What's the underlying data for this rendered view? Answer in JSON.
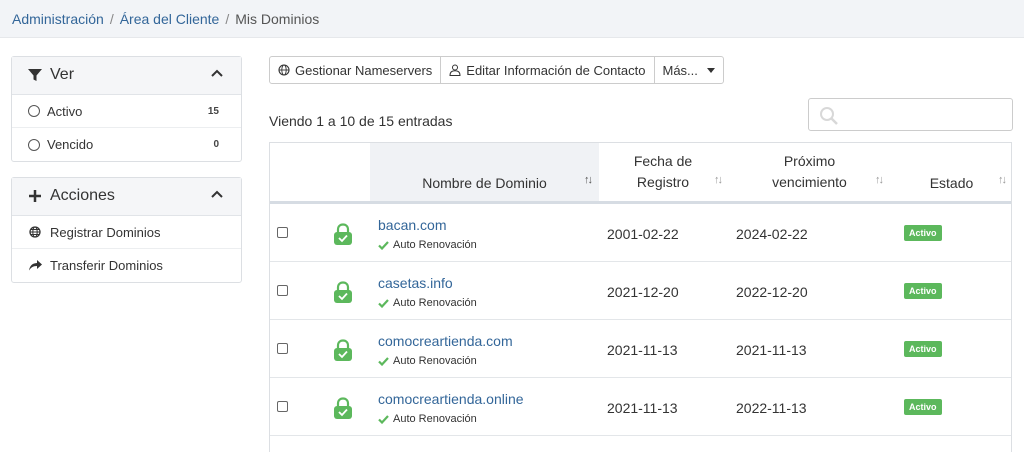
{
  "breadcrumb": {
    "items": [
      "Administración",
      "Área del Cliente"
    ],
    "current": "Mis Dominios",
    "separator": "/"
  },
  "sidebar": {
    "ver": {
      "title": "Ver",
      "icon": "filter-icon",
      "items": [
        {
          "label": "Activo",
          "count": "15"
        },
        {
          "label": "Vencido",
          "count": "0"
        }
      ]
    },
    "acciones": {
      "title": "Acciones",
      "icon": "plus-icon",
      "items": [
        {
          "label": "Registrar Dominios",
          "icon": "globe-icon"
        },
        {
          "label": "Transferir Dominios",
          "icon": "share-arrow-icon"
        }
      ]
    }
  },
  "toolbar": {
    "nameservers_label": "Gestionar Nameservers",
    "contact_label": "Editar Información de Contacto",
    "more_label": "Más..."
  },
  "listing": {
    "showing_text": "Viendo 1 a 10 de 15 entradas",
    "search_placeholder": ""
  },
  "table": {
    "columns": {
      "domain": "Nombre de Dominio",
      "registration": "Fecha de Registro",
      "expiry": "Próximo vencimiento",
      "status": "Estado"
    },
    "auto_renew_label": "Auto Renovación",
    "rows": [
      {
        "domain": "bacan.com",
        "registered": "2001-02-22",
        "expires": "2024-02-22",
        "status": "Activo"
      },
      {
        "domain": "casetas.info",
        "registered": "2021-12-20",
        "expires": "2022-12-20",
        "status": "Activo"
      },
      {
        "domain": "comocreartienda.com",
        "registered": "2021-11-13",
        "expires": "2021-11-13",
        "status": "Activo"
      },
      {
        "domain": "comocreartienda.online",
        "registered": "2021-11-13",
        "expires": "2022-11-13",
        "status": "Activo"
      }
    ]
  },
  "colors": {
    "link": "#336699",
    "active_badge": "#5cb85c",
    "lock": "#5cb85c"
  }
}
